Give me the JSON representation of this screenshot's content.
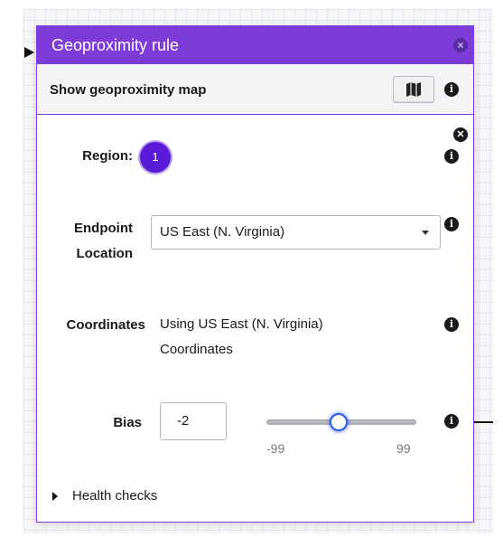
{
  "panel": {
    "title": "Geoproximity rule",
    "close_glyph": "×"
  },
  "map_row": {
    "label": "Show geoproximity map",
    "map_icon": "map-icon"
  },
  "region": {
    "label": "Region:",
    "badge": "1"
  },
  "endpoint": {
    "label_line1": "Endpoint",
    "label_line2": "Location",
    "selected": "US East (N. Virginia)"
  },
  "coordinates": {
    "label": "Coordinates",
    "value_line1": "Using US East (N. Virginia)",
    "value_line2": "Coordinates"
  },
  "bias": {
    "label": "Bias",
    "value": "-2",
    "min_label": "-99",
    "max_label": "99"
  },
  "health_checks": {
    "label": "Health checks"
  },
  "colors": {
    "header": "#7d3cd8",
    "badge": "#5a1bd9",
    "slider_thumb": "#2d5be3"
  }
}
